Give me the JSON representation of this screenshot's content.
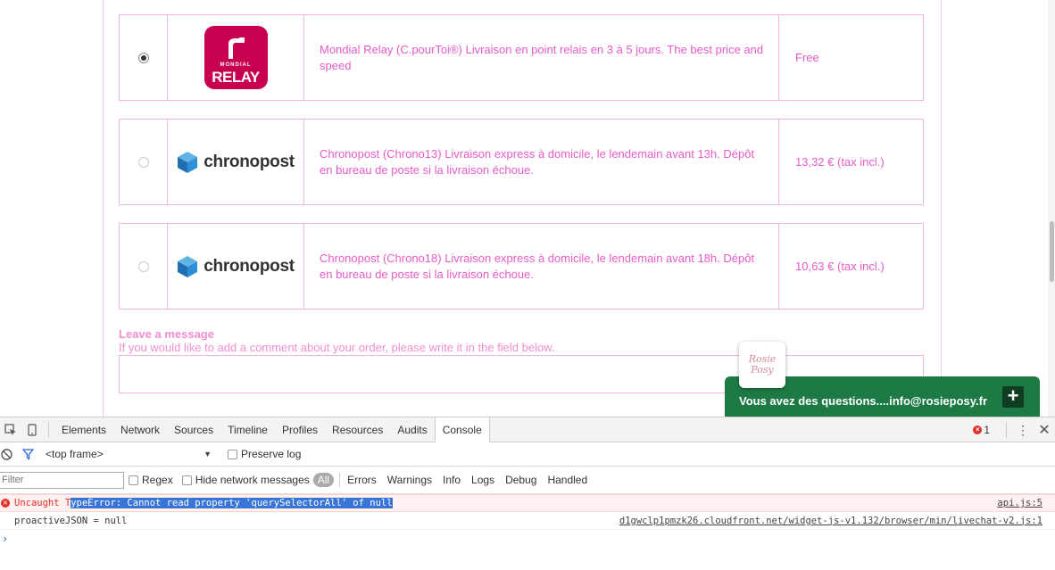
{
  "carriers": [
    {
      "name": "Mondial Relay",
      "logo_text_small": "MONDIAL",
      "logo_text_big": "RELAY",
      "description": "Mondial Relay (C.pourToi®) Livraison en point relais en 3 à 5 jours. The best price and speed",
      "price": "Free",
      "selected": true
    },
    {
      "name": "Chronopost Chrono13",
      "logo_text": "chronopost",
      "description": "Chronopost (Chrono13) Livraison express à domicile, le lendemain avant 13h. Dépôt en bureau de poste si la livraison échoue.",
      "price": "13,32 € (tax incl.)",
      "selected": false
    },
    {
      "name": "Chronopost Chrono18",
      "logo_text": "chronopost",
      "description": "Chronopost (Chrono18) Livraison express à domicile, le lendemain avant 18h. Dépôt en bureau de poste si la livraison échoue.",
      "price": "10,63 € (tax incl.)",
      "selected": false
    }
  ],
  "message": {
    "title": "Leave a message",
    "hint": "If you would like to add a comment about your order, please write it in the field below."
  },
  "chat": {
    "badge_line1": "Rosie",
    "badge_line2": "Posy",
    "label": "Vous avez des questions....info@rosieposy.fr",
    "plus": "+"
  },
  "devtools": {
    "tabs": [
      "Elements",
      "Network",
      "Sources",
      "Timeline",
      "Profiles",
      "Resources",
      "Audits",
      "Console"
    ],
    "active_tab": "Console",
    "error_count": "1",
    "frame": "<top frame>",
    "preserve_log": "Preserve log",
    "filter_placeholder": "Filter",
    "regex": "Regex",
    "hide_network": "Hide network messages",
    "levels": [
      "All",
      "Errors",
      "Warnings",
      "Info",
      "Logs",
      "Debug",
      "Handled"
    ],
    "messages": [
      {
        "prefix": "Uncaught T",
        "highlight": "ypeError: Cannot read property 'querySelectorAll' of null",
        "source": "api.js:5",
        "type": "error"
      },
      {
        "text": "proactiveJSON = null",
        "source": "d1gwclp1pmzk26.cloudfront.net/widget-js-v1.132/browser/min/livechat-v2.js:1",
        "type": "log"
      }
    ],
    "prompt": "›"
  },
  "colors": {
    "accent_pink": "#e75bc8",
    "border_pink": "#f0b5e3",
    "mondial_red": "#c7004f",
    "chat_green": "#1d7a45",
    "error_red": "#e0302a"
  }
}
